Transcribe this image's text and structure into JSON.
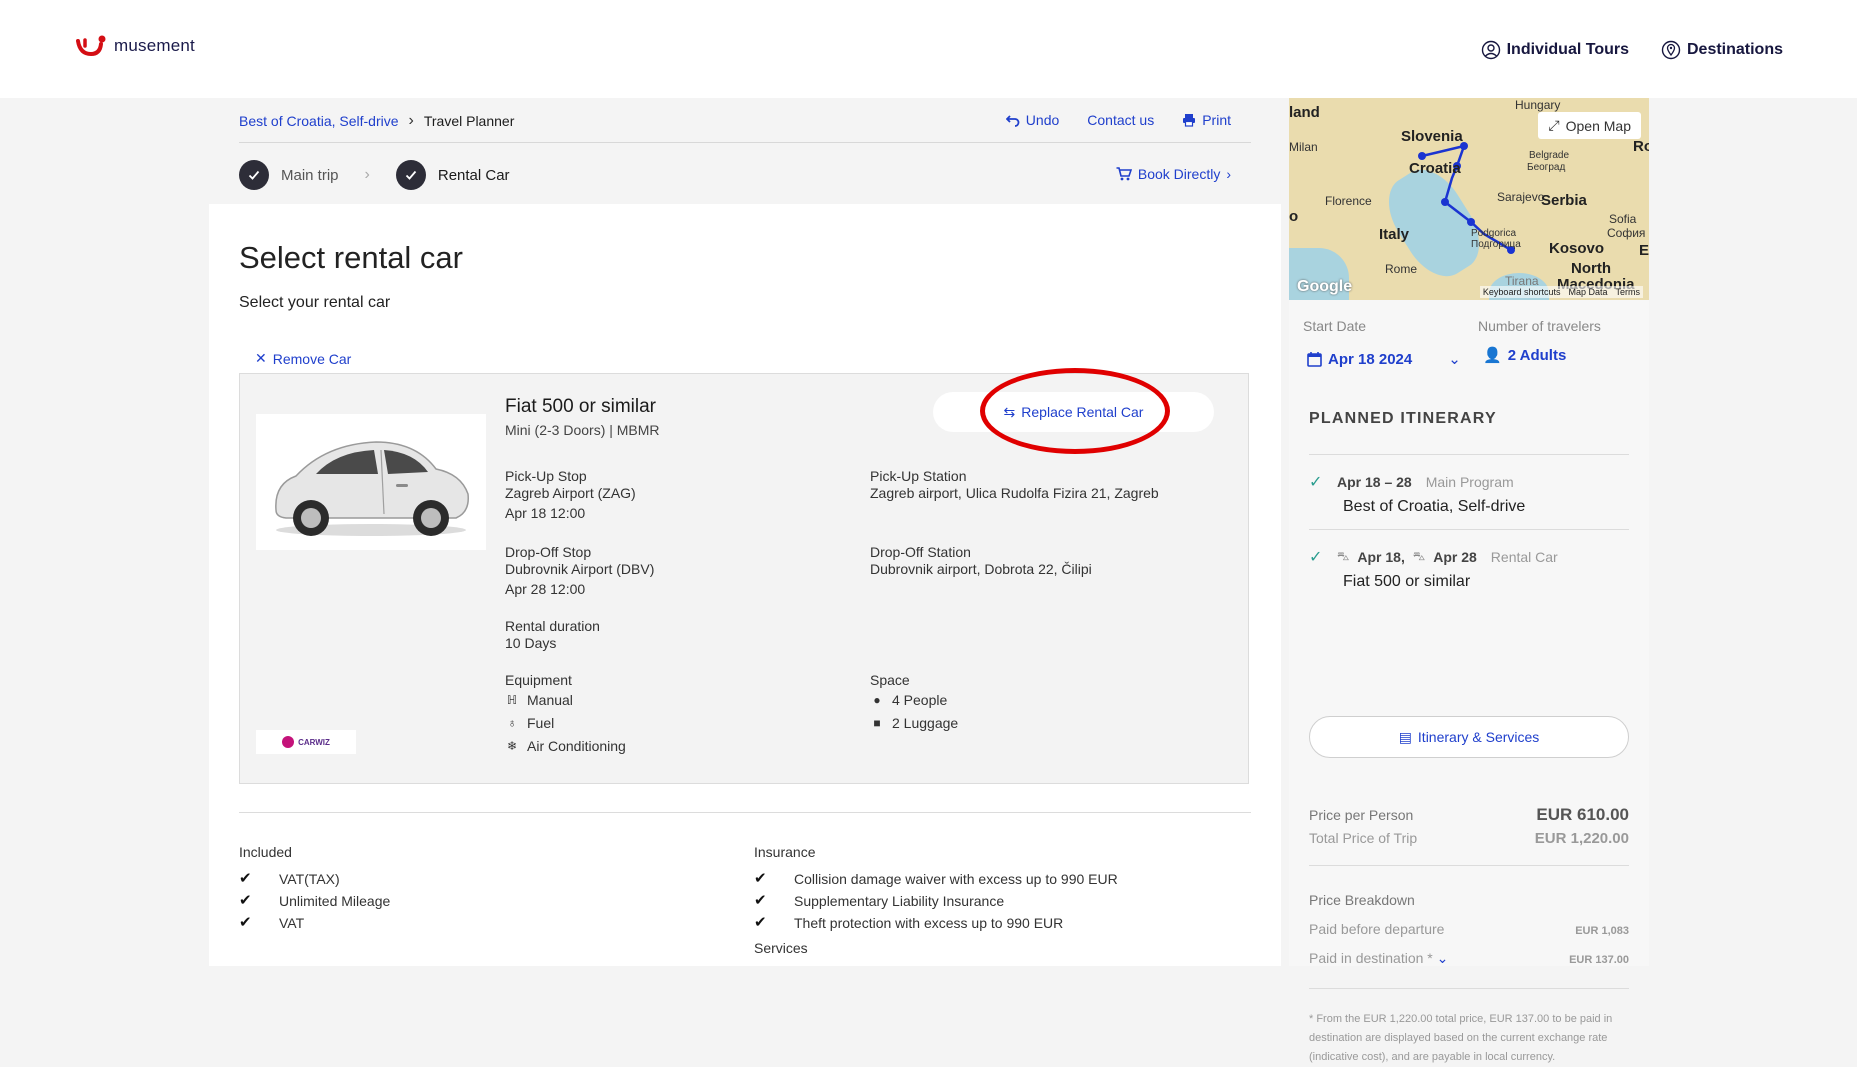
{
  "topbar": {
    "logo_text": "musement",
    "nav": [
      {
        "label": "Individual Tours",
        "icon": "person-circle-icon"
      },
      {
        "label": "Destinations",
        "icon": "location-pin-icon"
      }
    ]
  },
  "header": {
    "breadcrumb": {
      "link": "Best of Croatia, Self-drive",
      "current": "Travel Planner"
    },
    "actions": {
      "undo": "Undo",
      "contact": "Contact us",
      "print": "Print"
    },
    "steps": [
      {
        "label": "Main trip",
        "done": true
      },
      {
        "label": "Rental Car",
        "done": true
      }
    ],
    "book_directly": "Book Directly"
  },
  "main": {
    "title": "Select rental car",
    "subtitle": "Select your rental car",
    "remove_car": "Remove Car",
    "car": {
      "name": "Fiat 500 or similar",
      "class": "Mini (2-3 Doors) | MBMR",
      "replace_label": "Replace Rental Car",
      "supplier": "CARWIZ",
      "pickup_stop_label": "Pick-Up Stop",
      "pickup_stop": "Zagreb Airport (ZAG)",
      "pickup_time": "Apr 18 12:00",
      "pickup_station_label": "Pick-Up Station",
      "pickup_station": "Zagreb airport, Ulica Rudolfa Fizira 21, Zagreb",
      "dropoff_stop_label": "Drop-Off Stop",
      "dropoff_stop": "Dubrovnik Airport (DBV)",
      "dropoff_time": "Apr 28 12:00",
      "dropoff_station_label": "Drop-Off Station",
      "dropoff_station": "Dubrovnik airport, Dobrota 22, Čilipi",
      "duration_label": "Rental duration",
      "duration": "10 Days",
      "equipment_label": "Equipment",
      "equipment": [
        "Manual",
        "Fuel",
        "Air Conditioning"
      ],
      "space_label": "Space",
      "space": [
        "4 People",
        "2 Luggage"
      ]
    },
    "included": {
      "title": "Included",
      "items": [
        "VAT(TAX)",
        "Unlimited Mileage",
        "VAT"
      ]
    },
    "insurance": {
      "title": "Insurance",
      "items": [
        "Collision damage waiver with excess up to 990 EUR",
        "Supplementary Liability Insurance",
        "Theft protection with excess up to 990 EUR"
      ]
    },
    "services_title": "Services"
  },
  "sidebar": {
    "map": {
      "open_map": "Open Map",
      "labels": [
        "Hungary",
        "Slovenia",
        "Milan",
        "Croatia",
        "Belgrade",
        "Београд",
        "Florence",
        "Sarajevo",
        "Serbia",
        "Sofia",
        "София",
        "Italy",
        "Podgorica",
        "Подгорица",
        "Kosovo",
        "Rome",
        "North",
        "Macedonia",
        "land",
        "Ro",
        "E",
        "o",
        "Tirana"
      ],
      "google": "Google",
      "footer": [
        "Keyboard shortcuts",
        "Map Data",
        "Terms"
      ]
    },
    "start_date_label": "Start Date",
    "start_date": "Apr 18 2024",
    "travelers_label": "Number of travelers",
    "travelers": "2 Adults",
    "itinerary_title": "PLANNED ITINERARY",
    "itinerary": [
      {
        "dates": "Apr 18 – 28",
        "category": "Main Program",
        "name": "Best of Croatia, Self-drive"
      },
      {
        "date_from": "Apr 18,",
        "date_to": "Apr 28",
        "category": "Rental Car",
        "name": "Fiat 500 or similar"
      }
    ],
    "itinerary_button": "Itinerary & Services",
    "price_per_person_label": "Price per Person",
    "price_per_person": "EUR 610.00",
    "total_price_label": "Total Price of Trip",
    "total_price": "EUR 1,220.00",
    "breakdown_label": "Price Breakdown",
    "paid_before_label": "Paid before departure",
    "paid_before": "EUR 1,083",
    "paid_dest_label": "Paid in destination *",
    "paid_dest": "EUR 137.00",
    "footnote": "* From the EUR 1,220.00 total price, EUR 137.00 to be paid in destination are displayed based on the current exchange rate (indicative cost), and are payable in local currency."
  },
  "colors": {
    "accent": "#1f3fcc",
    "logo_red": "#d40e14",
    "highlight": "#e00000",
    "check_green": "#2a9d8f"
  }
}
